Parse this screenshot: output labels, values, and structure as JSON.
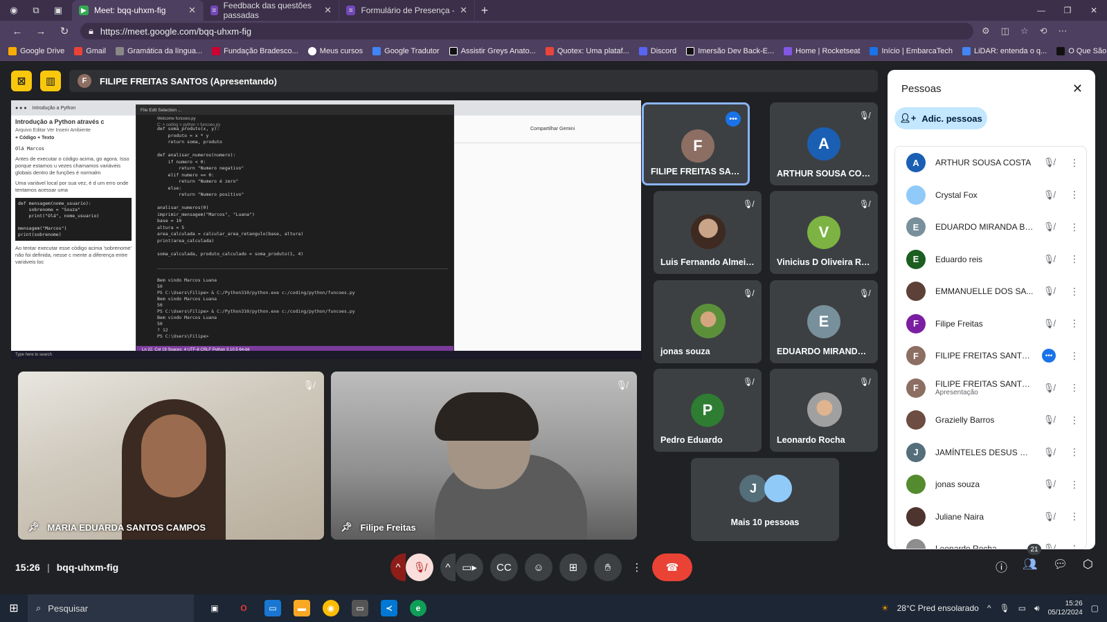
{
  "browser": {
    "tabs": [
      {
        "label": "Meet: bqq-uhxm-fig",
        "active": true,
        "color": "#34a853"
      },
      {
        "label": "Feedback das questões passadas",
        "active": false,
        "color": "#7248b9"
      },
      {
        "label": "Formulário de Presença - ACEX D",
        "active": false,
        "color": "#7248b9"
      }
    ],
    "url": "https://meet.google.com/bqq-uhxm-fig",
    "bookmarks": [
      {
        "label": "Google Drive",
        "color": "#f9ab00"
      },
      {
        "label": "Gmail",
        "color": "#ea4335"
      },
      {
        "label": "Gramática da língua...",
        "color": "#888888"
      },
      {
        "label": "Fundação Bradesco...",
        "color": "#cc0033"
      },
      {
        "label": "Meus cursos",
        "color": "#ffffff"
      },
      {
        "label": "Google Tradutor",
        "color": "#4285f4"
      },
      {
        "label": "Assistir Greys Anato...",
        "color": "#111111"
      },
      {
        "label": "Quotex: Uma plataf...",
        "color": "#e8453c"
      },
      {
        "label": "Discord",
        "color": "#5865f2"
      },
      {
        "label": "Imersão Dev Back-E...",
        "color": "#111111"
      },
      {
        "label": "Home | Rocketseat",
        "color": "#8257e5"
      },
      {
        "label": "Início | EmbarcaTech",
        "color": "#1a73e8"
      },
      {
        "label": "LiDAR: entenda o q...",
        "color": "#4285f4"
      },
      {
        "label": "O Que São Chips de...",
        "color": "#111111"
      }
    ]
  },
  "presenter": {
    "initial": "F",
    "label": "FILIPE FREITAS SANTOS (Apresentando)",
    "avatar_color": "#8d6e63"
  },
  "shared_screen": {
    "colab_title": "Introdução a Python através c",
    "colab_menu": "Arquivo  Editar  Ver  Inserir  Ambiente",
    "colab_add": "+ Código   + Texto",
    "colab_output": "Olá Marcos",
    "colab_p1": "Antes de executar o código acima, go agora. Isso porque estamos u vezes chamamos variáveis globais dentro de funções é normalm",
    "colab_p2": "Uma variável local por sua vez, é d um erro onde tentamos acessar uma",
    "colab_code": "def mensagem(nome_usuario):\n    sobrenome = \"Souza\"\n    print(\"Olá\", nome_usuario)\n\nmensagem(\"Marcos\")\nprint(sobrenome)",
    "colab_p3": "Ao tentar executar esse código acima 'sobrenome' não foi definida, nesse c mente a diferença entre variáveis loc",
    "vs_tabs": "Welcome    funcoes.py",
    "vs_path": "C: > coding > python > funcoes.py",
    "vs_code": "def soma_produto(x, y):\n    produto = x * y\n    return soma, produto\n\ndef analisar_numeros(numero):\n    if numero < 0:\n        return \"Numero negativo\"\n    elif numero == 0:\n        return \"Numero é zero\"\n    else:\n        return \"Numero positivo\"\n\nanalisar_numeros(0)\nimprimir_mensagem(\"Marcos\", \"Luana\")\nbase = 10\naltura = 5\narea_calculada = calcular_area_retangulo(base, altura)\nprint(area_calculada)\n\nsoma_calculada, produto_calculado = soma_produto(1, 4)",
    "vs_terminal": "Bem vindo Marcos Luana\n50\nPS C:\\Users\\Filipe> & C:/Python310/python.exe c:/coding/python/funcoes.py\nBem vindo Marcos Luana\n50\nPS C:\\Users\\Filipe> & C:/Python310/python.exe c:/coding/python/funcoes.py\nBem vindo Marcos Luana\n50\n? 12\nPS C:\\Users\\Filipe>",
    "vs_status": "Ln 22, Col 19   Spaces: 4   UTF-8   CRLF   Python   3.10.5 64-bit",
    "right_toolbar": "Compartilhar   Gemini",
    "mini_taskbar": "Type here to search"
  },
  "videos": [
    {
      "name": "MARIA EDUARDA SANTOS CAMPOS"
    },
    {
      "name": "Filipe Freitas"
    }
  ],
  "tiles": [
    {
      "name": "FILIPE FREITAS SANTOS",
      "initial": "F",
      "color": "#8d6e63"
    },
    {
      "name": "ARTHUR SOUSA COSTA",
      "initial": "A",
      "color": "#1a5fb4"
    },
    {
      "name": "Luis Fernando Almeid...",
      "initial": "",
      "color": "#6d4c41"
    },
    {
      "name": "Vinicius D Oliveira Ro...",
      "initial": "V",
      "color": "#7cb342"
    },
    {
      "name": "jonas souza",
      "initial": "",
      "color": "#558b2f"
    },
    {
      "name": "EDUARDO MIRANDA ...",
      "initial": "E",
      "color": "#78909c"
    },
    {
      "name": "Pedro Eduardo",
      "initial": "P",
      "color": "#2e7d32"
    },
    {
      "name": "Leonardo Rocha",
      "initial": "",
      "color": "#8d8d8d"
    }
  ],
  "more": {
    "label": "Mais 10 pessoas",
    "initial": "J",
    "color": "#546e7a"
  },
  "panel": {
    "title": "Pessoas",
    "add_label": "Adic. pessoas",
    "people": [
      {
        "name": "ARTHUR SOUSA COSTA",
        "initial": "A",
        "color": "#1a5fb4",
        "sub": ""
      },
      {
        "name": "Crystal Fox",
        "initial": "",
        "color": "#90caf9",
        "sub": ""
      },
      {
        "name": "EDUARDO MIRANDA BE...",
        "initial": "E",
        "color": "#78909c",
        "sub": ""
      },
      {
        "name": "Eduardo reis",
        "initial": "E",
        "color": "#1b5e20",
        "sub": ""
      },
      {
        "name": "EMMANUELLE DOS SA...",
        "initial": "",
        "color": "#5d4037",
        "sub": ""
      },
      {
        "name": "Filipe Freitas",
        "initial": "F",
        "color": "#7b1fa2",
        "sub": ""
      },
      {
        "name": "FILIPE FREITAS SANTOS",
        "initial": "F",
        "color": "#8d6e63",
        "sub": ""
      },
      {
        "name": "FILIPE FREITAS SANTOS",
        "initial": "F",
        "color": "#8d6e63",
        "sub": "Apresentação"
      },
      {
        "name": "Grazielly Barros",
        "initial": "",
        "color": "#6d4c41",
        "sub": ""
      },
      {
        "name": "JAMÍNTELES DESUS RIB...",
        "initial": "J",
        "color": "#546e7a",
        "sub": ""
      },
      {
        "name": "jonas souza",
        "initial": "",
        "color": "#558b2f",
        "sub": ""
      },
      {
        "name": "Juliane Naira",
        "initial": "",
        "color": "#4e342e",
        "sub": ""
      },
      {
        "name": "Leonardo Rocha",
        "initial": "",
        "color": "#8d8d8d",
        "sub": ""
      }
    ]
  },
  "footer": {
    "time": "15:26",
    "code": "bqq-uhxm-fig",
    "participant_count": "21"
  },
  "taskbar": {
    "search": "Pesquisar",
    "weather": "28°C  Pred ensolarado",
    "time": "15:26",
    "date": "05/12/2024"
  }
}
